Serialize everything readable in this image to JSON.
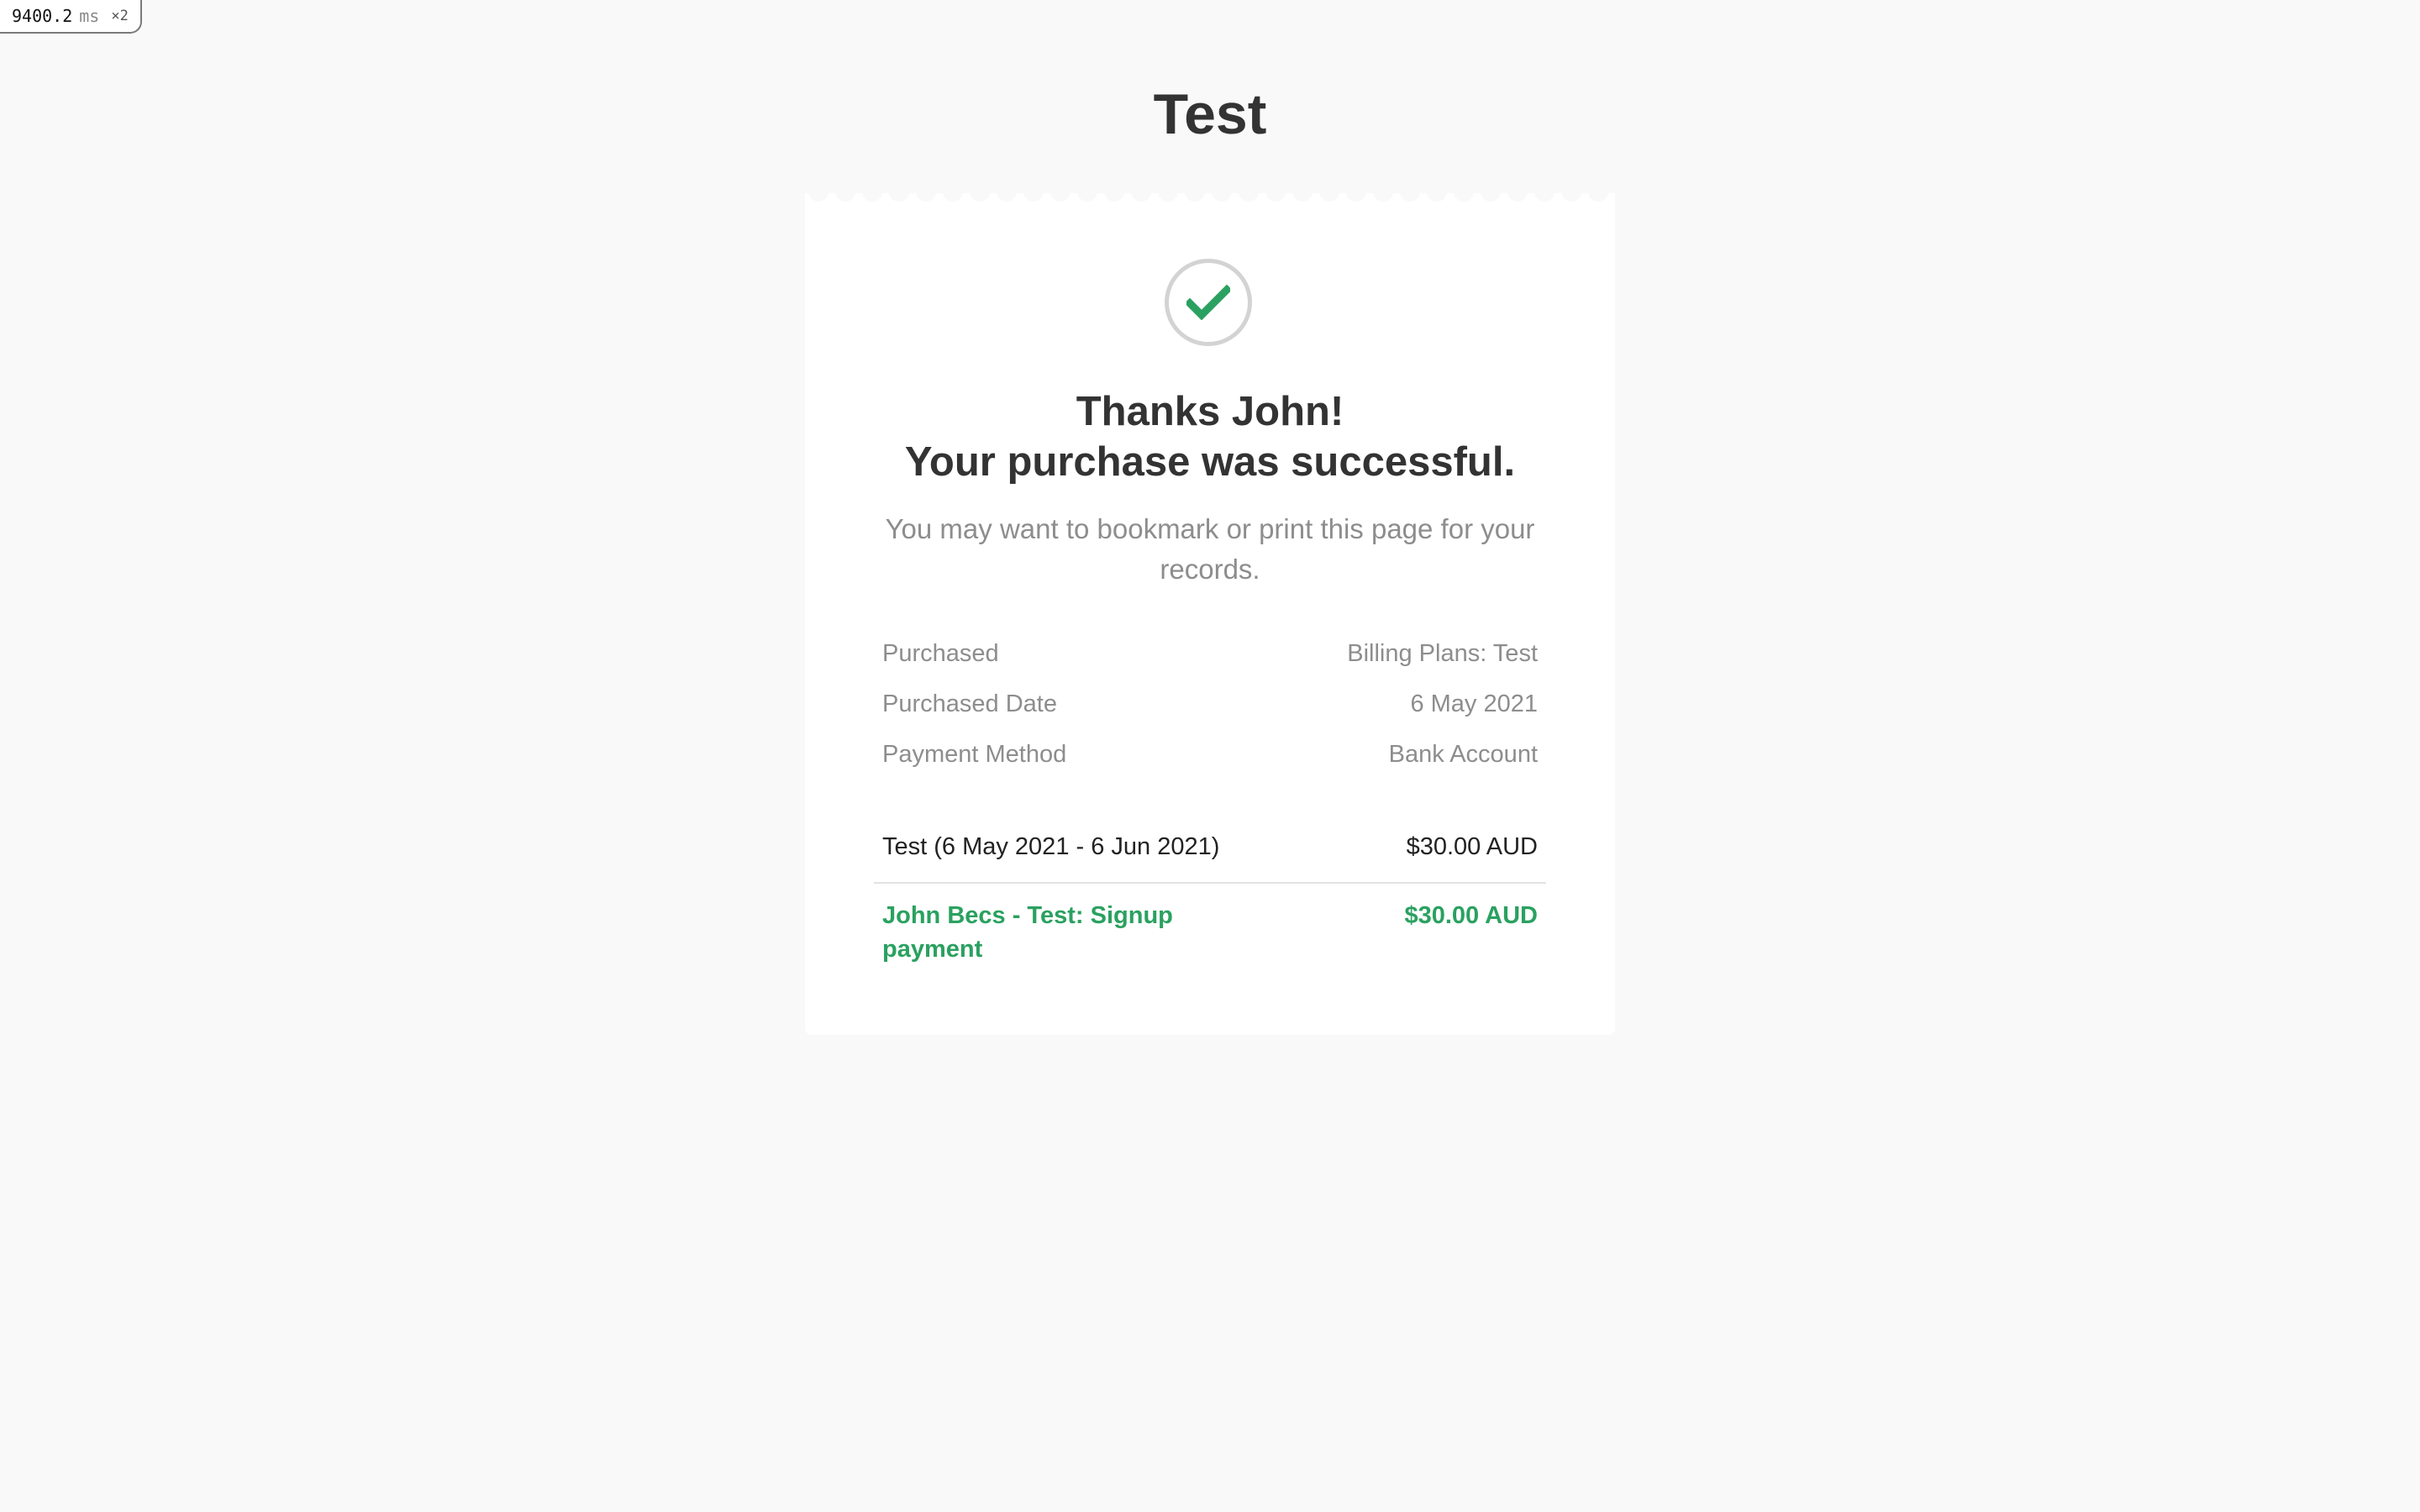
{
  "perf_badge": {
    "value": "9400.2",
    "unit": "ms",
    "multiplier": "×2"
  },
  "page": {
    "title": "Test"
  },
  "receipt": {
    "status_icon": "checkmark-icon",
    "headline_line1": "Thanks John!",
    "headline_line2": "Your purchase was successful.",
    "subtext": "You may want to bookmark or print this page for your records.",
    "details": [
      {
        "label": "Purchased",
        "value": "Billing Plans: Test"
      },
      {
        "label": "Purchased Date",
        "value": "6 May 2021"
      },
      {
        "label": "Payment Method",
        "value": "Bank Account"
      }
    ],
    "line_item": {
      "label": "Test (6 May 2021 - 6 Jun 2021)",
      "amount": "$30.00 AUD"
    },
    "total": {
      "label": "John Becs - Test: Signup payment",
      "amount": "$30.00 AUD"
    }
  },
  "colors": {
    "background": "#f9f9f9",
    "card": "#ffffff",
    "success_green": "#2aa160",
    "muted_text": "#8d8d8d",
    "heading_text": "#333333"
  }
}
